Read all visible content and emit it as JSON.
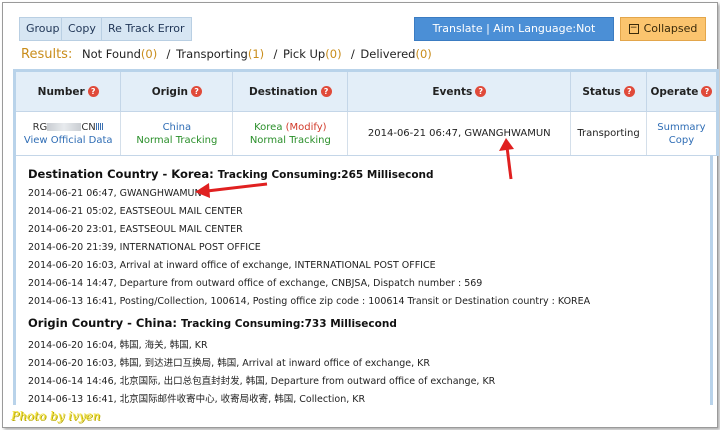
{
  "toolbar": {
    "group_label": "Group",
    "copy_label": "Copy",
    "retrack_label": "Re Track Error",
    "translate_label": "Translate | Aim Language:Not Translated",
    "collapse_icon": "minus-box-icon",
    "collapse_label": "Collapsed"
  },
  "results": {
    "label": "Results:",
    "items": [
      {
        "label": "Not Found",
        "count": "0"
      },
      {
        "label": "Transporting",
        "count": "1"
      },
      {
        "label": "Pick Up",
        "count": "0"
      },
      {
        "label": "Delivered",
        "count": "0"
      }
    ]
  },
  "table": {
    "headers": [
      "Number",
      "Origin",
      "Destination",
      "Events",
      "Status",
      "Operate"
    ],
    "row": {
      "number_prefix": "RG",
      "number_suffix": "CN",
      "view_official": "View Official Data",
      "origin_country": "China",
      "origin_status": "Normal Tracking",
      "dest_country": "Korea",
      "dest_modify": "(Modify)",
      "dest_status": "Normal Tracking",
      "event": "2014-06-21 06:47, GWANGHWAMUN",
      "status": "Transporting",
      "op_summary": "Summary",
      "op_copy": "Copy"
    }
  },
  "destination": {
    "heading": "Destination Country - Korea:",
    "consuming": "Tracking Consuming:265 Millisecond",
    "events": [
      "2014-06-21 06:47, GWANGHWAMUN",
      "2014-06-21 05:02, EASTSEOUL MAIL CENTER",
      "2014-06-20 23:01, EASTSEOUL MAIL CENTER",
      "2014-06-20 21:39, INTERNATIONAL POST OFFICE",
      "2014-06-20 16:03, Arrival at inward office of exchange, INTERNATIONAL POST OFFICE",
      "2014-06-14 14:47, Departure from outward office of exchange, CNBJSA, Dispatch number : 569",
      "2014-06-13 16:41, Posting/Collection, 100614, Posting office zip code : 100614 Transit or Destination country : KOREA"
    ]
  },
  "origin": {
    "heading": "Origin Country - China:",
    "consuming": "Tracking Consuming:733 Millisecond",
    "events": [
      "2014-06-20 16:04, 韩国, 海关, 韩国, KR",
      "2014-06-20 16:03, 韩国, 到达进口互换局, 韩国, Arrival at inward office of exchange, KR",
      "2014-06-14 14:46, 北京国际, 出口总包直封封发, 韩国, Departure from outward office of exchange, KR",
      "2014-06-13 16:41, 北京国际邮件收寄中心, 收寄局收寄, 韩国, Collection, KR"
    ]
  },
  "watermark": "Photo by ivyen"
}
